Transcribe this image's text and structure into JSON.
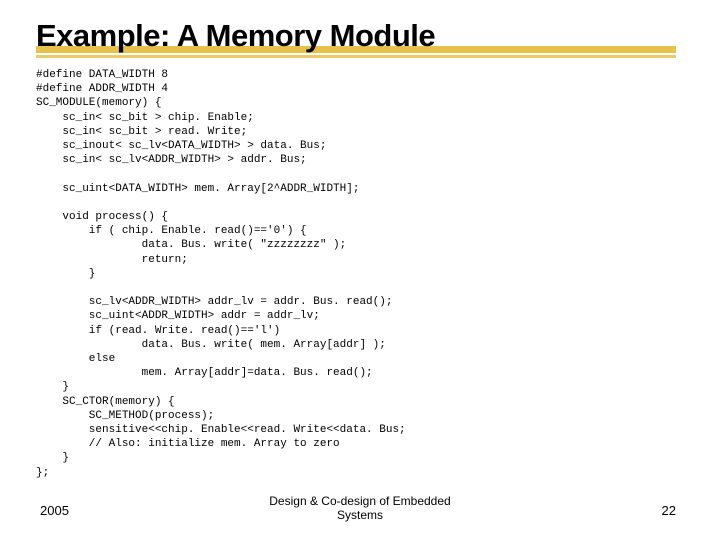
{
  "title": "Example: A Memory Module",
  "code": "#define DATA_WIDTH 8\n#define ADDR_WIDTH 4\nSC_MODULE(memory) {\n    sc_in< sc_bit > chip. Enable;\n    sc_in< sc_bit > read. Write;\n    sc_inout< sc_lv<DATA_WIDTH> > data. Bus;\n    sc_in< sc_lv<ADDR_WIDTH> > addr. Bus;\n\n    sc_uint<DATA_WIDTH> mem. Array[2^ADDR_WIDTH];\n\n    void process() {\n        if ( chip. Enable. read()=='0') {\n                data. Bus. write( \"zzzzzzzz\" );\n                return;\n        }\n\n        sc_lv<ADDR_WIDTH> addr_lv = addr. Bus. read();\n        sc_uint<ADDR_WIDTH> addr = addr_lv;\n        if (read. Write. read()=='l')\n                data. Bus. write( mem. Array[addr] );\n        else\n                mem. Array[addr]=data. Bus. read();\n    }\n    SC_CTOR(memory) {\n        SC_METHOD(process);\n        sensitive<<chip. Enable<<read. Write<<data. Bus;\n        // Also: initialize mem. Array to zero\n    }\n};",
  "footer": {
    "left": "2005",
    "center_line1": "Design & Co-design of Embedded",
    "center_line2": "Systems",
    "right": "22"
  }
}
